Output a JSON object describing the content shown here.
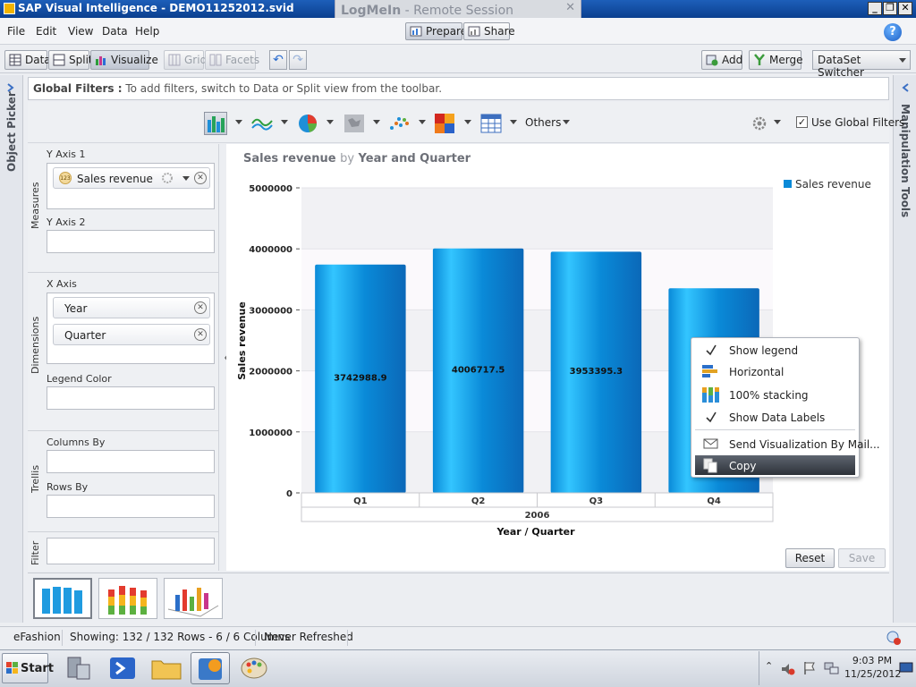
{
  "window": {
    "title": "SAP Visual Intelligence - DEMO11252012.svid",
    "controls": [
      "_",
      "❐",
      "✕"
    ]
  },
  "logmein": {
    "brand": "LogMeIn",
    "separator": " - ",
    "subtitle": "Remote Session",
    "close": "✕"
  },
  "menubar": {
    "items": [
      "File",
      "Edit",
      "View",
      "Data",
      "Help"
    ],
    "modes": {
      "prepare": "Prepare",
      "share": "Share"
    },
    "help_icon": "?"
  },
  "toolbar": {
    "data": "Data",
    "split": "Split",
    "visualize": "Visualize",
    "grid": "Grid",
    "facets": "Facets",
    "undo": "↶",
    "redo": "↷",
    "add": "Add",
    "merge": "Merge",
    "dataset_switcher": "DataSet Switcher"
  },
  "side_tabs": {
    "left": "Object Picker",
    "right": "Manipulation Tools"
  },
  "global_filters": {
    "label": "Global Filters :",
    "hint": "To add filters, switch to Data or Split view from the toolbar."
  },
  "chart_toolbar": {
    "others": "Others",
    "use_global_filters": "Use Global Filters",
    "use_global_filters_checked": true
  },
  "feed_panel": {
    "measures_label": "Measures",
    "y_axis_1_label": "Y Axis 1",
    "y_axis_1_item": "Sales revenue",
    "y_axis_1_badge": "123",
    "y_axis_2_label": "Y Axis 2",
    "dimensions_label": "Dimensions",
    "x_axis_label": "X Axis",
    "x_axis_items": [
      "Year",
      "Quarter"
    ],
    "legend_color_label": "Legend Color",
    "trellis_label": "Trellis",
    "columns_by_label": "Columns By",
    "rows_by_label": "Rows By",
    "filter_label": "Filter"
  },
  "chart": {
    "title_measure": "Sales revenue",
    "title_by": "by",
    "title_dims": "Year and Quarter",
    "legend": "Sales revenue",
    "colors": {
      "bar": "#0a8ad8",
      "bar_light": "#33c5ff",
      "bar_dark": "#0b68b8"
    }
  },
  "chart_data": {
    "type": "bar",
    "categories": [
      "Q1",
      "Q2",
      "Q3",
      "Q4"
    ],
    "group_label": "2006",
    "values": [
      3742988.9,
      4006717.5,
      3953395.3,
      3355000
    ],
    "data_labels": [
      "3742988.9",
      "4006717.5",
      "3953395.3",
      ""
    ],
    "ylabel": "Sales revenue",
    "xlabel": "Year / Quarter",
    "y_ticks": [
      "0",
      "1000000",
      "2000000",
      "3000000",
      "4000000",
      "5000000"
    ],
    "ylim": [
      0,
      5000000
    ],
    "legend_position": "top-right",
    "series": [
      {
        "name": "Sales revenue",
        "values": [
          3742988.9,
          4006717.5,
          3953395.3,
          3355000
        ]
      }
    ]
  },
  "buttons": {
    "reset": "Reset",
    "save": "Save"
  },
  "context_menu": {
    "items": [
      {
        "label": "Show legend",
        "icon": "check-icon"
      },
      {
        "label": "Horizontal",
        "icon": "horizontal-icon"
      },
      {
        "label": "100% stacking",
        "icon": "stacking-icon"
      },
      {
        "label": "Show Data Labels",
        "icon": "check-icon"
      },
      {
        "label": "Send Visualization By Mail...",
        "icon": "mail-icon"
      },
      {
        "label": "Copy",
        "icon": "copy-icon"
      }
    ]
  },
  "status": {
    "dataset": "eFashion",
    "showing": "Showing: 132 / 132 Rows - 6 / 6 Columns",
    "refresh": "Never Refreshed"
  },
  "taskbar": {
    "start": "Start",
    "time": "9:03 PM",
    "date": "11/25/2012"
  }
}
